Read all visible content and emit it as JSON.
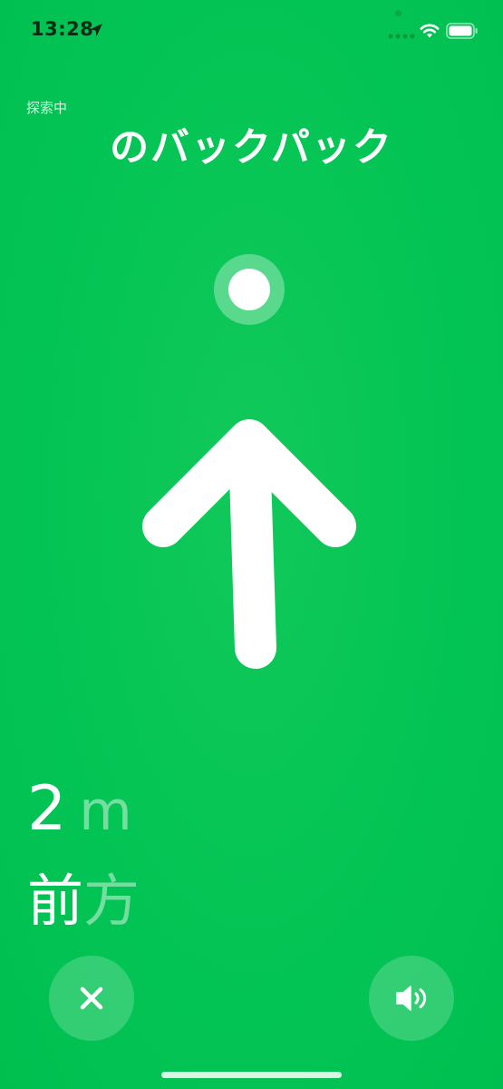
{
  "status_bar": {
    "time": "13:28",
    "icons": [
      "location-arrow-icon",
      "signal-dots-icon",
      "wifi-icon",
      "battery-icon"
    ]
  },
  "header": {
    "search_status": "探索中",
    "item_name": "のバックパック"
  },
  "navigation": {
    "distance_value": "2",
    "distance_unit": "m",
    "direction_main": "前",
    "direction_sub": "方"
  },
  "buttons": {
    "close_icon": "close-icon",
    "sound_icon": "speaker-icon"
  },
  "colors": {
    "background": "#00C853",
    "foreground": "#FFFFFF"
  }
}
